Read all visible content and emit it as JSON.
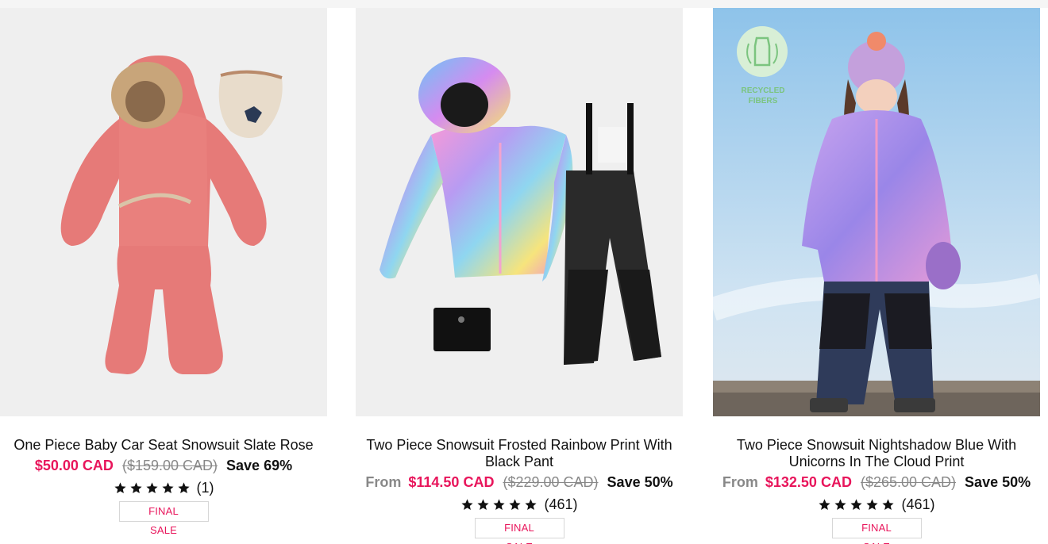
{
  "colors": {
    "accent": "#e8155b",
    "muted": "#888888",
    "text": "#111111",
    "image_bg": "#efefef"
  },
  "products": [
    {
      "title": "One Piece Baby Car Seat Snowsuit Slate Rose",
      "from_label": "",
      "sale_price": "$50.00 CAD",
      "original_price": "($159.00 CAD)",
      "savings": "Save 69%",
      "rating": 5,
      "review_count": "(1)",
      "badge": "FINAL SALE",
      "image_icon": "pink-baby-snowsuit-image"
    },
    {
      "title": "Two Piece Snowsuit Frosted Rainbow Print With Black Pant",
      "from_label": "From",
      "sale_price": "$114.50 CAD",
      "original_price": "($229.00 CAD)",
      "savings": "Save 50%",
      "rating": 5,
      "review_count": "(461)",
      "badge": "FINAL SALE",
      "image_icon": "rainbow-jacket-black-pant-image"
    },
    {
      "title": "Two Piece Snowsuit Nightshadow Blue With Unicorns In The Cloud Print",
      "from_label": "From",
      "sale_price": "$132.50 CAD",
      "original_price": "($265.00 CAD)",
      "savings": "Save 50%",
      "rating": 5,
      "review_count": "(461)",
      "badge": "FINAL SALE",
      "image_icon": "child-wearing-snowsuit-image",
      "image_badge": "RECYCLED FIBERS"
    }
  ]
}
